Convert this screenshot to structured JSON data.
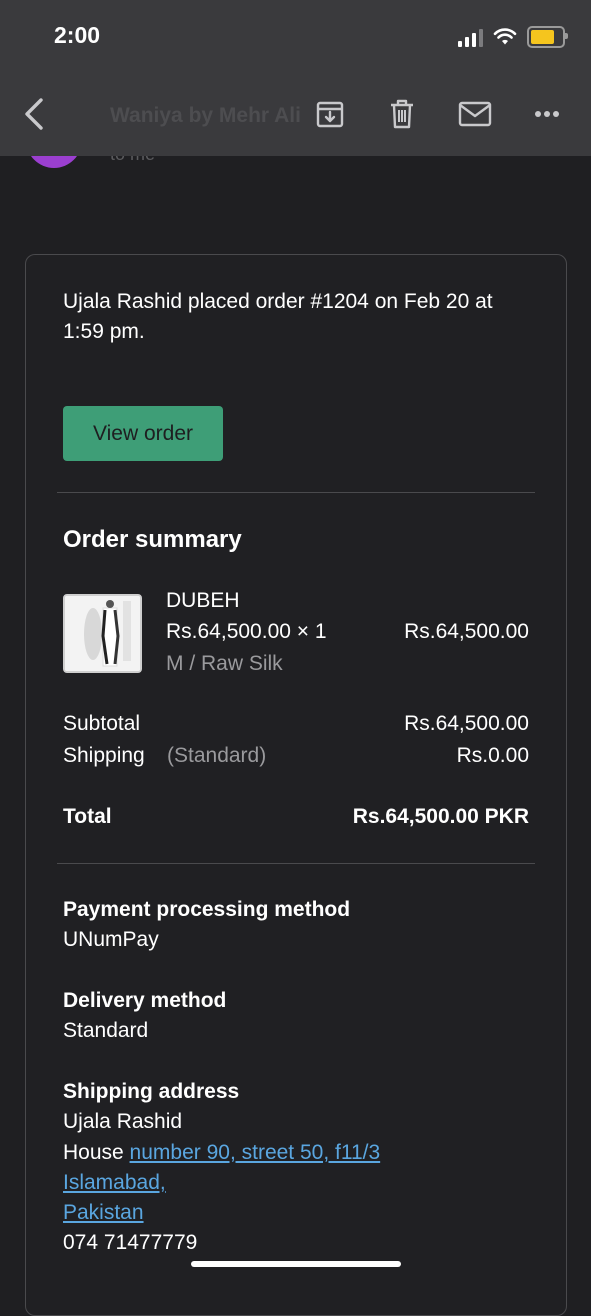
{
  "status_bar": {
    "time": "2:00"
  },
  "email": {
    "sender": "Waniya by Mehr Ali",
    "to": "to me"
  },
  "colors": {
    "accent": "#3e9e77",
    "link": "#5aa6e0",
    "avatar": "#9b3fd0",
    "battery": "#f5c51e"
  },
  "toolbar": {
    "icons": [
      "back-icon",
      "archive-icon",
      "trash-icon",
      "mail-icon",
      "more-icon"
    ]
  },
  "order": {
    "intro": "Ujala Rashid placed order #1204 on Feb 20 at 1:59 pm.",
    "view_button": "View order",
    "summary_title": "Order summary",
    "item": {
      "name": "DUBEH",
      "price_qty": "Rs.64,500.00 × 1",
      "line_total": "Rs.64,500.00",
      "variant": "M / Raw Silk"
    },
    "subtotal_label": "Subtotal",
    "subtotal_value": "Rs.64,500.00",
    "shipping_label": "Shipping",
    "shipping_type": "(Standard)",
    "shipping_value": "Rs.0.00",
    "total_label": "Total",
    "total_value": "Rs.64,500.00 PKR"
  },
  "details": {
    "payment_title": "Payment processing method",
    "payment_value": "UNumPay",
    "delivery_title": "Delivery method",
    "delivery_value": "Standard",
    "shipping_title": "Shipping address",
    "address_name": "Ujala Rashid",
    "address_prefix": "House",
    "address_line1_link": "number 90, street 50, f11/3",
    "address_line2_link": "Islamabad, ",
    "address_line3_link": "Pakistan",
    "phone": "074 71477779"
  }
}
